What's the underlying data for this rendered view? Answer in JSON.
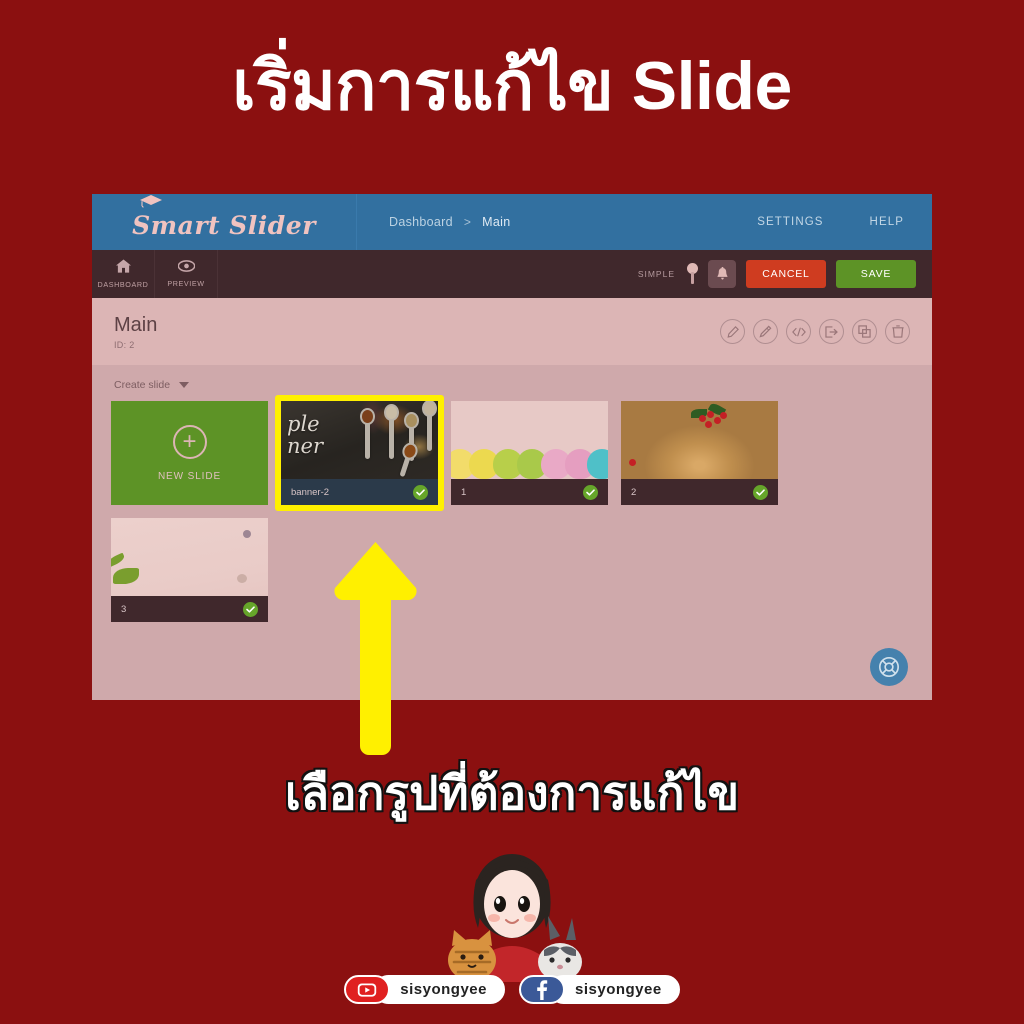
{
  "overlay": {
    "title_top": "เริ่มการแก้ไข Slide",
    "caption_bottom": "เลือกรูปที่ต้องการแก้ไข",
    "highlight_color": "#FFF000",
    "background_color": "#8B1010"
  },
  "app": {
    "logo_text": "Smart Slider",
    "header_bg": "#3270a0",
    "breadcrumb": {
      "root": "Dashboard",
      "separator": ">",
      "current": "Main"
    },
    "header_links": {
      "settings": "SETTINGS",
      "help": "HELP"
    },
    "toolbar": {
      "tabs": [
        {
          "label": "DASHBOARD",
          "icon": "home-icon"
        },
        {
          "label": "PREVIEW",
          "icon": "eye-icon"
        }
      ],
      "simple_label": "SIMPLE",
      "bell_icon": "bell-icon",
      "cancel_label": "CANCEL",
      "save_label": "SAVE",
      "cancel_color": "#cf3c20",
      "save_color": "#5d9326"
    },
    "slider": {
      "name": "Main",
      "id_label": "ID: 2",
      "actions": [
        {
          "name": "edit-icon"
        },
        {
          "name": "magic-wand-icon"
        },
        {
          "name": "code-icon"
        },
        {
          "name": "export-icon"
        },
        {
          "name": "duplicate-icon"
        },
        {
          "name": "trash-icon"
        }
      ]
    },
    "create_slide_label": "Create slide",
    "new_slide_label": "NEW SLIDE",
    "slides": [
      {
        "name": "banner-2",
        "selected": true,
        "published": true,
        "art": "banner2",
        "overlay_text_1": "ple",
        "overlay_text_2": "ner"
      },
      {
        "name": "1",
        "selected": false,
        "published": true,
        "art": "macaron"
      },
      {
        "name": "2",
        "selected": false,
        "published": true,
        "art": "bread"
      },
      {
        "name": "3",
        "selected": false,
        "published": true,
        "art": "light"
      }
    ],
    "support_icon": "life-ring-icon"
  },
  "socials": [
    {
      "platform": "youtube",
      "icon": "youtube-icon",
      "handle": "sisyongyee",
      "color": "#e02020"
    },
    {
      "platform": "facebook",
      "icon": "facebook-icon",
      "handle": "sisyongyee",
      "color": "#3b5998"
    }
  ]
}
